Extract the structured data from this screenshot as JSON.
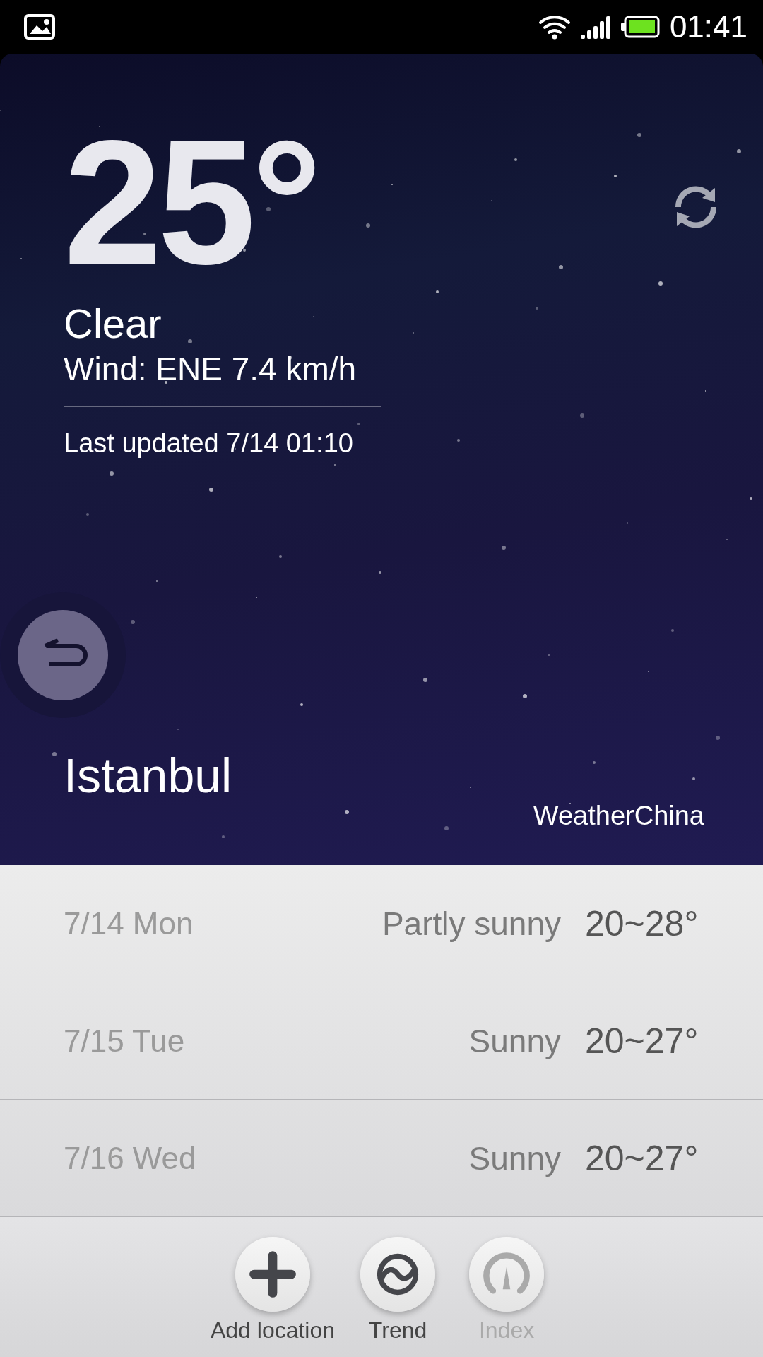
{
  "status_bar": {
    "time": "01:41"
  },
  "current": {
    "temperature": "25°",
    "condition": "Clear",
    "wind": "Wind: ENE 7.4 km/h",
    "last_updated": "Last updated 7/14 01:10",
    "city": "Istanbul",
    "source": "WeatherChina"
  },
  "forecast": [
    {
      "date": "7/14 Mon",
      "condition": "Partly sunny",
      "range": "20~28°"
    },
    {
      "date": "7/15 Tue",
      "condition": "Sunny",
      "range": "20~27°"
    },
    {
      "date": "7/16 Wed",
      "condition": "Sunny",
      "range": "20~27°"
    }
  ],
  "actions": [
    {
      "kind": "add",
      "label": "Add location",
      "disabled": false
    },
    {
      "kind": "trend",
      "label": "Trend",
      "disabled": false
    },
    {
      "kind": "index",
      "label": "Index",
      "disabled": true
    }
  ]
}
